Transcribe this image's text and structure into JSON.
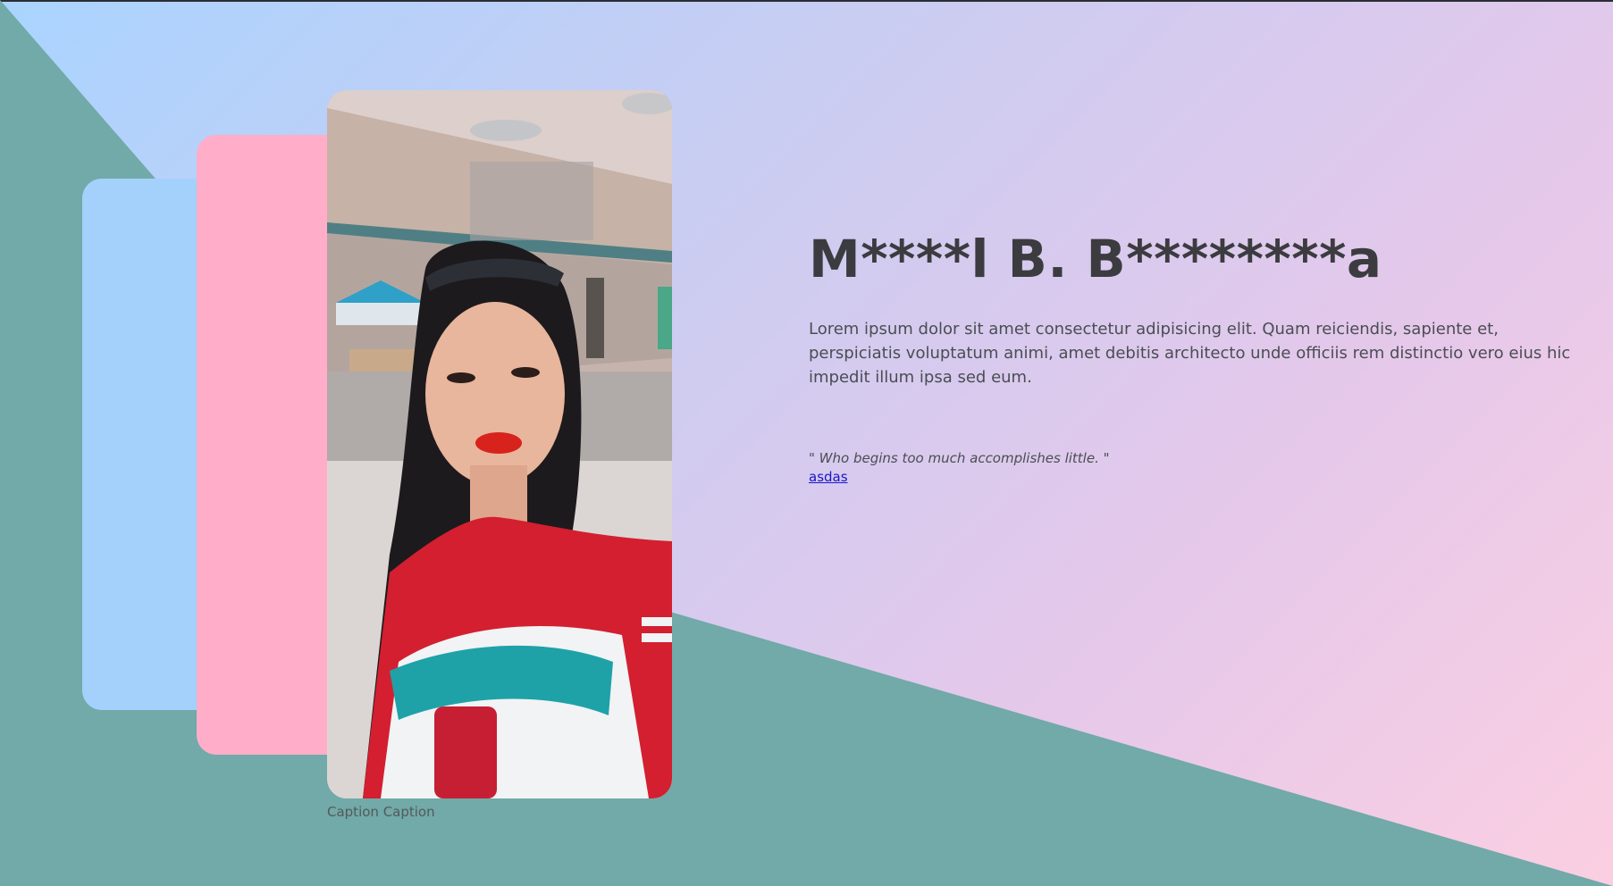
{
  "profile": {
    "name": "M****l B. B********a",
    "bio": "Lorem ipsum dolor sit amet consectetur adipisicing elit. Quam reiciendis, sapiente et, perspiciatis voluptatum animi, amet debitis architecto unde officiis rem distinctio vero eius hic impedit illum ipsa sed eum.",
    "quote": "\" Who begins too much accomplishes little. \"",
    "link_text": "asdas"
  },
  "photo": {
    "caption": "Caption Caption"
  },
  "colors": {
    "background_start": "#a9d4ff",
    "background_end": "#fbcfe2",
    "teal": "#71aaa8",
    "card_blue": "#a4d1fb",
    "card_pink": "#ffadc8",
    "heading": "#3c3c40",
    "link": "#1a14c9"
  }
}
